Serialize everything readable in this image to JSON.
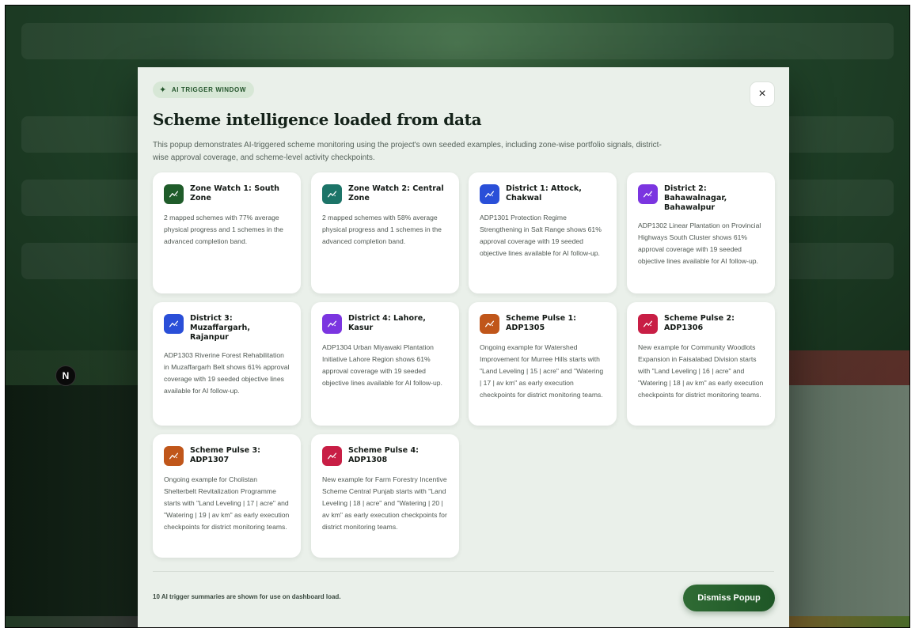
{
  "pill": {
    "label": "AI TRIGGER WINDOW",
    "icon": "sparkle-icon"
  },
  "modal": {
    "title": "Scheme intelligence loaded from data",
    "description": "This popup demonstrates AI-triggered scheme monitoring using the project's own seeded examples, including zone-wise portfolio signals, district-wise approval coverage, and scheme-level activity checkpoints.",
    "close_label": "×"
  },
  "badge": {
    "label": "N"
  },
  "cards": [
    {
      "title": "Zone Watch 1: South Zone",
      "color": "#1f5c2a",
      "body": "2 mapped schemes with 77% average physical progress and 1 schemes in the advanced completion band."
    },
    {
      "title": "Zone Watch 2: Central Zone",
      "color": "#1c7468",
      "body": "2 mapped schemes with 58% average physical progress and 1 schemes in the advanced completion band."
    },
    {
      "title": "District 1: Attock, Chakwal",
      "color": "#2a4fd8",
      "body": "ADP1301 Protection Regime Strengthening in Salt Range shows 61% approval coverage with 19 seeded objective lines available for AI follow-up."
    },
    {
      "title": "District 2: Bahawalnagar, Bahawalpur",
      "color": "#7b35e0",
      "body": "ADP1302 Linear Plantation on Provincial Highways South Cluster shows 61% approval coverage with 19 seeded objective lines available for AI follow-up."
    },
    {
      "title": "District 3: Muzaffargarh, Rajanpur",
      "color": "#2a4fd8",
      "body": "ADP1303 Riverine Forest Rehabilitation in Muzaffargarh Belt shows 61% approval coverage with 19 seeded objective lines available for AI follow-up."
    },
    {
      "title": "District 4: Lahore, Kasur",
      "color": "#7b35e0",
      "body": "ADP1304 Urban Miyawaki Plantation Initiative Lahore Region shows 61% approval coverage with 19 seeded objective lines available for AI follow-up."
    },
    {
      "title": "Scheme Pulse 1: ADP1305",
      "color": "#c0561a",
      "body": "Ongoing example for Watershed Improvement for Murree Hills starts with \"Land Leveling | 15 | acre\" and \"Watering | 17 | av km\" as early execution checkpoints for district monitoring teams."
    },
    {
      "title": "Scheme Pulse 2: ADP1306",
      "color": "#c81e45",
      "body": "New example for Community Woodlots Expansion in Faisalabad Division starts with \"Land Leveling | 16 | acre\" and \"Watering | 18 | av km\" as early execution checkpoints for district monitoring teams."
    },
    {
      "title": "Scheme Pulse 3: ADP1307",
      "color": "#c0561a",
      "body": "Ongoing example for Cholistan Shelterbelt Revitalization Programme starts with \"Land Leveling | 17 | acre\" and \"Watering | 19 | av km\" as early execution checkpoints for district monitoring teams."
    },
    {
      "title": "Scheme Pulse 4: ADP1308",
      "color": "#c81e45",
      "body": "New example for Farm Forestry Incentive Scheme Central Punjab starts with \"Land Leveling | 18 | acre\" and \"Watering | 20 | av km\" as early execution checkpoints for district monitoring teams."
    }
  ],
  "footer": {
    "note": "10 AI trigger summaries are shown for use on dashboard load.",
    "dismiss_label": "Dismiss Popup"
  }
}
